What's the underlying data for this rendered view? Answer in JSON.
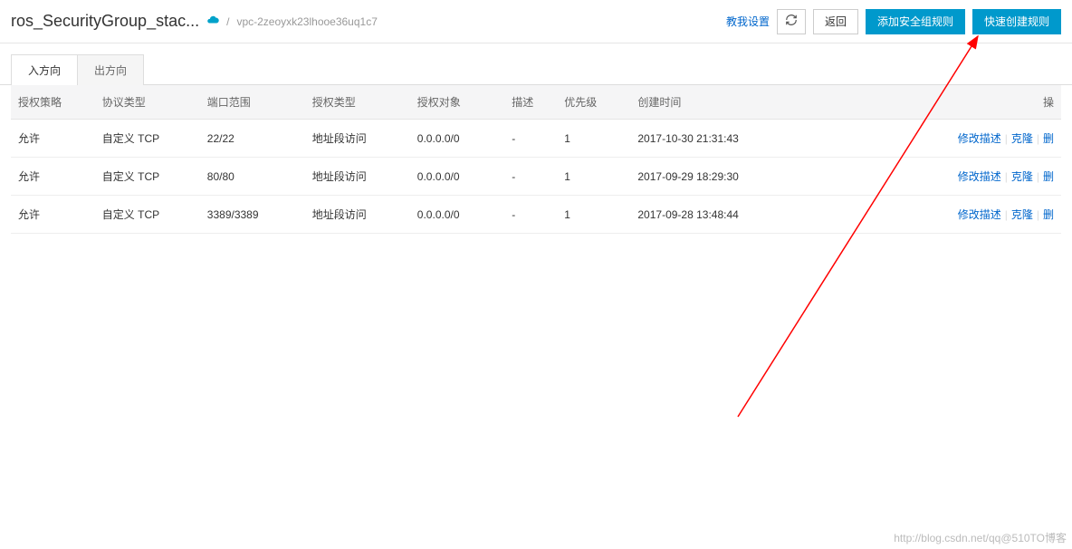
{
  "header": {
    "title": "ros_SecurityGroup_stac...",
    "vpc_id": "vpc-2zeoyxk23lhooe36uq1c7",
    "separator": "/",
    "tutorial_link": "教我设置",
    "refresh_label": "↻",
    "back_button": "返回",
    "add_rule_button": "添加安全组规则",
    "quick_create_button": "快速创建规则"
  },
  "tabs": {
    "inbound": "入方向",
    "outbound": "出方向"
  },
  "table": {
    "headers": {
      "policy": "授权策略",
      "protocol": "协议类型",
      "port": "端口范围",
      "auth_type": "授权类型",
      "auth_object": "授权对象",
      "description": "描述",
      "priority": "优先级",
      "create_time": "创建时间",
      "ops": "操"
    },
    "rows": [
      {
        "policy": "允许",
        "protocol": "自定义 TCP",
        "port": "22/22",
        "auth_type": "地址段访问",
        "auth_object": "0.0.0.0/0",
        "description": "-",
        "priority": "1",
        "create_time": "2017-10-30 21:31:43"
      },
      {
        "policy": "允许",
        "protocol": "自定义 TCP",
        "port": "80/80",
        "auth_type": "地址段访问",
        "auth_object": "0.0.0.0/0",
        "description": "-",
        "priority": "1",
        "create_time": "2017-09-29 18:29:30"
      },
      {
        "policy": "允许",
        "protocol": "自定义 TCP",
        "port": "3389/3389",
        "auth_type": "地址段访问",
        "auth_object": "0.0.0.0/0",
        "description": "-",
        "priority": "1",
        "create_time": "2017-09-28 13:48:44"
      }
    ],
    "ops": {
      "modify": "修改描述",
      "clone": "克隆",
      "delete": "删"
    }
  },
  "watermark": "http://blog.csdn.net/qq@510TO博客"
}
